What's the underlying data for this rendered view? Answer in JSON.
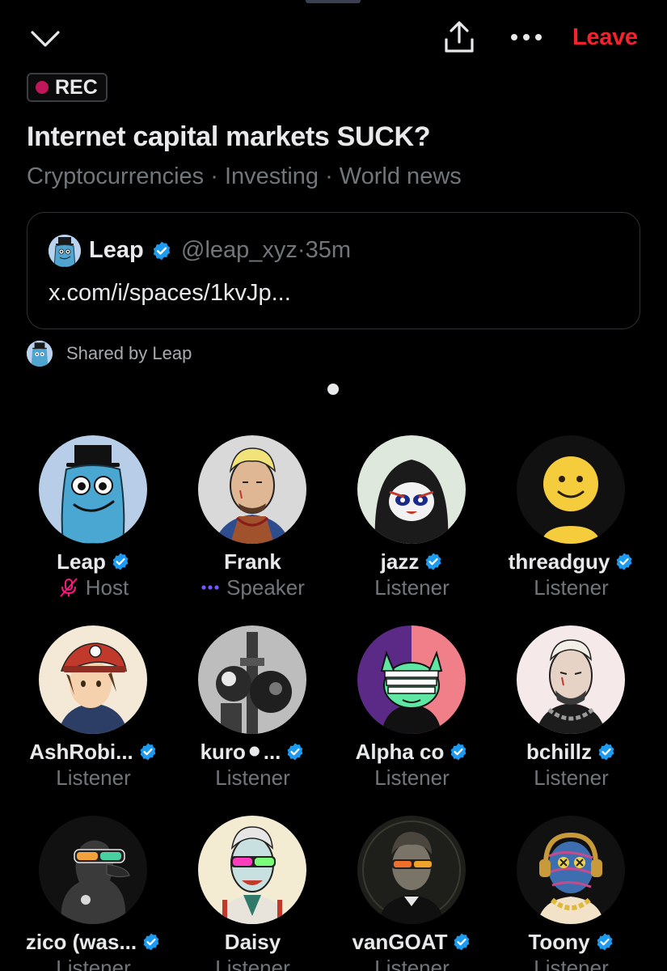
{
  "header": {
    "leave_label": "Leave",
    "collapse_icon": "chevron-down-icon",
    "share_icon": "share-upload-icon",
    "more_icon": "more-dots-icon"
  },
  "recording": {
    "label": "REC",
    "dot_color": "#c0165a"
  },
  "space": {
    "title": "Internet capital markets SUCK?",
    "topics": "Cryptocurrencies · Investing · World news"
  },
  "shared_post": {
    "author": "Leap",
    "handle": "@leap_xyz",
    "separator": "·",
    "time": "35m",
    "link_text": "x.com/i/spaces/1kvJp..."
  },
  "shared_by": "Shared by Leap",
  "colors": {
    "accent_red": "#f4212e",
    "verified_blue": "#1d9bf0",
    "muted": "#71767b"
  },
  "participants": [
    {
      "name": "Leap",
      "verified": true,
      "role": "Host",
      "role_icon": "mic-muted-icon"
    },
    {
      "name": "Frank",
      "verified": false,
      "role": "Speaker",
      "role_icon": "speaking-dots-icon"
    },
    {
      "name": "jazz",
      "verified": true,
      "role": "Listener"
    },
    {
      "name": "threadguy",
      "verified": true,
      "role": "Listener"
    },
    {
      "name": "AshRobi...",
      "verified": true,
      "role": "Listener"
    },
    {
      "name": "kuro⚫...",
      "verified": true,
      "role": "Listener"
    },
    {
      "name": "Alpha co",
      "verified": true,
      "role": "Listener"
    },
    {
      "name": "bchillz",
      "verified": true,
      "role": "Listener"
    },
    {
      "name": "zico (was...",
      "verified": true,
      "role": "Listener"
    },
    {
      "name": "Daisy",
      "verified": false,
      "role": "Listener"
    },
    {
      "name": "vanGOAT",
      "verified": true,
      "role": "Listener"
    },
    {
      "name": "Toony",
      "verified": true,
      "role": "Listener"
    }
  ]
}
